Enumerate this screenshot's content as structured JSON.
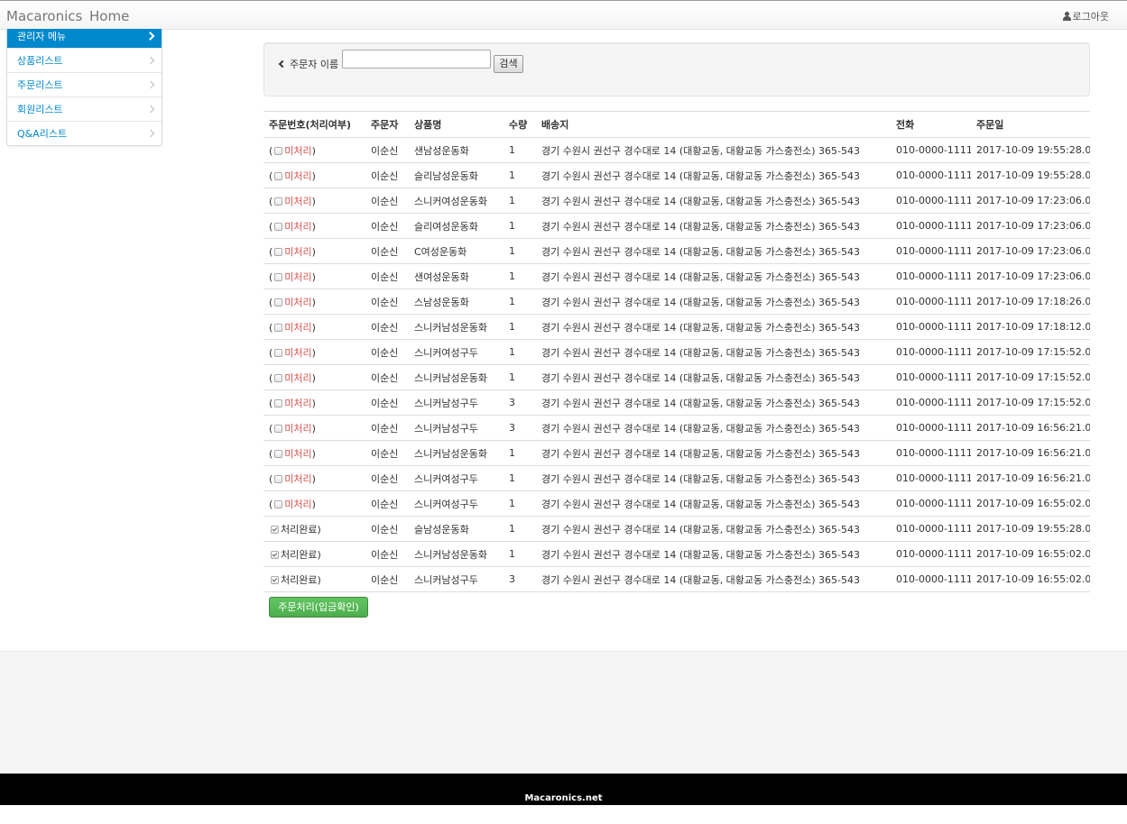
{
  "navbar": {
    "brand": "Macaronics",
    "home": "Home",
    "logout": "로그아웃"
  },
  "sidebar": {
    "items": [
      {
        "label": "관리자 메뉴"
      },
      {
        "label": "상품리스트"
      },
      {
        "label": "주문리스트"
      },
      {
        "label": "회원리스트"
      },
      {
        "label": "Q&A리스트"
      }
    ]
  },
  "search": {
    "label": "주문자 이름",
    "value": "",
    "button": "검색"
  },
  "table": {
    "headers": [
      "주문번호(처리여부)",
      "주문자",
      "상품명",
      "수량",
      "배송지",
      "전화",
      "주문일"
    ],
    "rows": [
      {
        "status": "미처리",
        "orderer": "이순신",
        "product": "샌남성운동화",
        "qty": "1",
        "address": "경기 수원시 권선구 경수대로 14 (대황교동, 대황교동 가스충전소) 365-543",
        "phone": "010-0000-1111",
        "date": "2017-10-09 19:55:28.0"
      },
      {
        "status": "미처리",
        "orderer": "이순신",
        "product": "슬리남성운동화",
        "qty": "1",
        "address": "경기 수원시 권선구 경수대로 14 (대황교동, 대황교동 가스충전소) 365-543",
        "phone": "010-0000-1111",
        "date": "2017-10-09 19:55:28.0"
      },
      {
        "status": "미처리",
        "orderer": "이순신",
        "product": "스니커여성운동화",
        "qty": "1",
        "address": "경기 수원시 권선구 경수대로 14 (대황교동, 대황교동 가스충전소) 365-543",
        "phone": "010-0000-1111",
        "date": "2017-10-09 17:23:06.0"
      },
      {
        "status": "미처리",
        "orderer": "이순신",
        "product": "슬리여성운동화",
        "qty": "1",
        "address": "경기 수원시 권선구 경수대로 14 (대황교동, 대황교동 가스충전소) 365-543",
        "phone": "010-0000-1111",
        "date": "2017-10-09 17:23:06.0"
      },
      {
        "status": "미처리",
        "orderer": "이순신",
        "product": "C여성운동화",
        "qty": "1",
        "address": "경기 수원시 권선구 경수대로 14 (대황교동, 대황교동 가스충전소) 365-543",
        "phone": "010-0000-1111",
        "date": "2017-10-09 17:23:06.0"
      },
      {
        "status": "미처리",
        "orderer": "이순신",
        "product": "샌여성운동화",
        "qty": "1",
        "address": "경기 수원시 권선구 경수대로 14 (대황교동, 대황교동 가스충전소) 365-543",
        "phone": "010-0000-1111",
        "date": "2017-10-09 17:23:06.0"
      },
      {
        "status": "미처리",
        "orderer": "이순신",
        "product": "스남성운동화",
        "qty": "1",
        "address": "경기 수원시 권선구 경수대로 14 (대황교동, 대황교동 가스충전소) 365-543",
        "phone": "010-0000-1111",
        "date": "2017-10-09 17:18:26.0"
      },
      {
        "status": "미처리",
        "orderer": "이순신",
        "product": "스니커남성운동화",
        "qty": "1",
        "address": "경기 수원시 권선구 경수대로 14 (대황교동, 대황교동 가스충전소) 365-543",
        "phone": "010-0000-1111",
        "date": "2017-10-09 17:18:12.0"
      },
      {
        "status": "미처리",
        "orderer": "이순신",
        "product": "스니커여성구두",
        "qty": "1",
        "address": "경기 수원시 권선구 경수대로 14 (대황교동, 대황교동 가스충전소) 365-543",
        "phone": "010-0000-1111",
        "date": "2017-10-09 17:15:52.0"
      },
      {
        "status": "미처리",
        "orderer": "이순신",
        "product": "스니커남성운동화",
        "qty": "1",
        "address": "경기 수원시 권선구 경수대로 14 (대황교동, 대황교동 가스충전소) 365-543",
        "phone": "010-0000-1111",
        "date": "2017-10-09 17:15:52.0"
      },
      {
        "status": "미처리",
        "orderer": "이순신",
        "product": "스니커남성구두",
        "qty": "3",
        "address": "경기 수원시 권선구 경수대로 14 (대황교동, 대황교동 가스충전소) 365-543",
        "phone": "010-0000-1111",
        "date": "2017-10-09 17:15:52.0"
      },
      {
        "status": "미처리",
        "orderer": "이순신",
        "product": "스니커남성구두",
        "qty": "3",
        "address": "경기 수원시 권선구 경수대로 14 (대황교동, 대황교동 가스충전소) 365-543",
        "phone": "010-0000-1111",
        "date": "2017-10-09 16:56:21.0"
      },
      {
        "status": "미처리",
        "orderer": "이순신",
        "product": "스니커남성운동화",
        "qty": "1",
        "address": "경기 수원시 권선구 경수대로 14 (대황교동, 대황교동 가스충전소) 365-543",
        "phone": "010-0000-1111",
        "date": "2017-10-09 16:56:21.0"
      },
      {
        "status": "미처리",
        "orderer": "이순신",
        "product": "스니커여성구두",
        "qty": "1",
        "address": "경기 수원시 권선구 경수대로 14 (대황교동, 대황교동 가스충전소) 365-543",
        "phone": "010-0000-1111",
        "date": "2017-10-09 16:56:21.0"
      },
      {
        "status": "미처리",
        "orderer": "이순신",
        "product": "스니커여성구두",
        "qty": "1",
        "address": "경기 수원시 권선구 경수대로 14 (대황교동, 대황교동 가스충전소) 365-543",
        "phone": "010-0000-1111",
        "date": "2017-10-09 16:55:02.0"
      },
      {
        "status": "처리완료",
        "orderer": "이순신",
        "product": "슬남성운동화",
        "qty": "1",
        "address": "경기 수원시 권선구 경수대로 14 (대황교동, 대황교동 가스충전소) 365-543",
        "phone": "010-0000-1111",
        "date": "2017-10-09 19:55:28.0"
      },
      {
        "status": "처리완료",
        "orderer": "이순신",
        "product": "스니커남성운동화",
        "qty": "1",
        "address": "경기 수원시 권선구 경수대로 14 (대황교동, 대황교동 가스충전소) 365-543",
        "phone": "010-0000-1111",
        "date": "2017-10-09 16:55:02.0"
      },
      {
        "status": "처리완료",
        "orderer": "이순신",
        "product": "스니커남성구두",
        "qty": "3",
        "address": "경기 수원시 권선구 경수대로 14 (대황교동, 대황교동 가스충전소) 365-543",
        "phone": "010-0000-1111",
        "date": "2017-10-09 16:55:02.0"
      }
    ]
  },
  "actions": {
    "submit": "주문처리(입금확인)"
  },
  "footer": {
    "text": "Macaronics.net"
  },
  "colors": {
    "accent": "#0088cc",
    "unprocessed": "#d9534f",
    "submit": "#5cb85c"
  }
}
